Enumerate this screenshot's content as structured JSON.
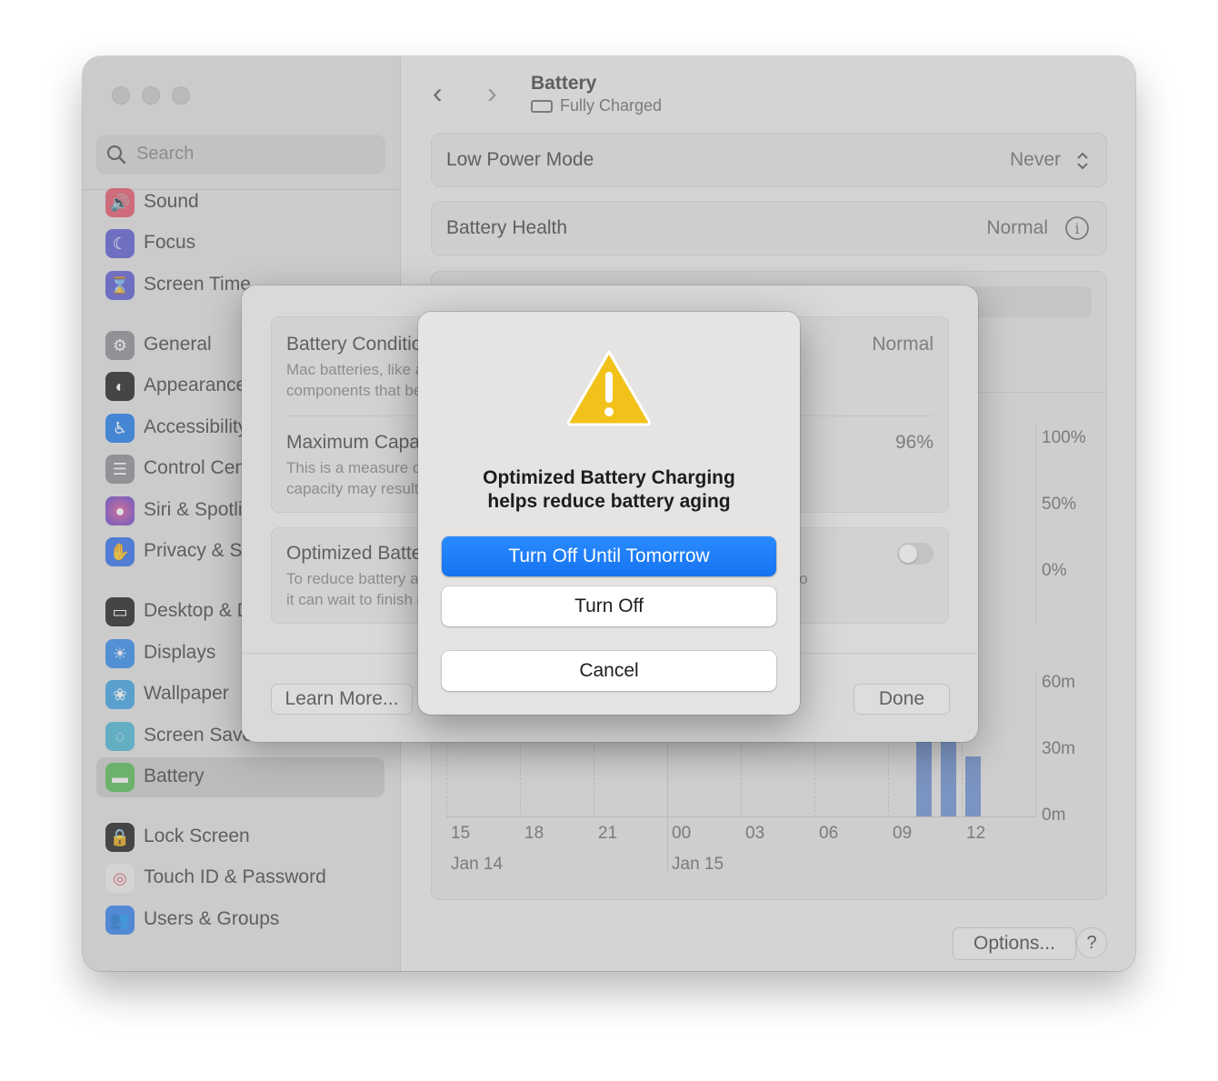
{
  "window": {
    "title": "Battery",
    "subtitle": "Fully Charged"
  },
  "sidebar": {
    "search_placeholder": "Search",
    "items": [
      {
        "label": "Sound",
        "icon": "speaker-icon",
        "color": "#e8566b"
      },
      {
        "label": "Focus",
        "icon": "moon-icon",
        "color": "#5a5ad6"
      },
      {
        "label": "Screen Time",
        "icon": "hourglass-icon",
        "color": "#5a5ad6"
      },
      {
        "label": "General",
        "icon": "gear-icon",
        "color": "#8e8e93"
      },
      {
        "label": "Appearance",
        "icon": "appearance-icon",
        "color": "#1c1c1e"
      },
      {
        "label": "Accessibility",
        "icon": "accessibility-icon",
        "color": "#1a7cf0"
      },
      {
        "label": "Control Centre",
        "icon": "control-centre-icon",
        "color": "#8e8e93"
      },
      {
        "label": "Siri & Spotlight",
        "icon": "siri-icon",
        "color": "#8a3fd6"
      },
      {
        "label": "Privacy & Security",
        "icon": "hand-icon",
        "color": "#2f6ff0"
      },
      {
        "label": "Desktop & Dock",
        "icon": "desktop-icon",
        "color": "#1c1c1e"
      },
      {
        "label": "Displays",
        "icon": "sun-icon",
        "color": "#2f8cf0"
      },
      {
        "label": "Wallpaper",
        "icon": "flower-icon",
        "color": "#3aa3e8"
      },
      {
        "label": "Screen Saver",
        "icon": "screensaver-icon",
        "color": "#48b8d8"
      },
      {
        "label": "Battery",
        "icon": "battery-icon",
        "color": "#5cc45c"
      },
      {
        "label": "Lock Screen",
        "icon": "lock-icon",
        "color": "#1c1c1e"
      },
      {
        "label": "Touch ID & Password",
        "icon": "fingerprint-icon",
        "color": "#f0f0f0"
      },
      {
        "label": "Users & Groups",
        "icon": "users-icon",
        "color": "#2f7ff0"
      }
    ]
  },
  "content": {
    "low_power_mode": {
      "label": "Low Power Mode",
      "value": "Never"
    },
    "battery_health": {
      "label": "Battery Health",
      "value": "Normal"
    },
    "chart": {
      "level_ticks": [
        "100%",
        "50%",
        "0%"
      ],
      "usage_ticks": [
        "60m",
        "30m",
        "0m"
      ],
      "hour_labels": [
        "15",
        "18",
        "21",
        "00",
        "03",
        "06",
        "09",
        "12"
      ],
      "date_labels": [
        "Jan 14",
        "Jan 15"
      ],
      "usage_bars_minutes": [
        58,
        58,
        27
      ]
    },
    "options_label": "Options...",
    "help_label": "?"
  },
  "sheet": {
    "condition": {
      "title": "Battery Condition",
      "desc1": "Mac batteries, like all rechargeable batteries, are consumable",
      "desc2": "components that become less effective as they age.",
      "value": "Normal"
    },
    "capacity": {
      "title": "Maximum Capacity",
      "desc1": "This is a measure of battery capacity relative to when it was new. Lower",
      "desc2": "capacity may result in fewer hours of use between charges.",
      "value": "96%"
    },
    "optimized": {
      "title": "Optimized Battery Charging",
      "desc1": "To reduce battery aging, your Mac learns from your daily charging routine so",
      "desc2": "it can wait to finish charging past 80% until you need to use it on battery."
    },
    "learn_more": "Learn More...",
    "done": "Done"
  },
  "alert": {
    "message_line1": "Optimized Battery Charging",
    "message_line2": "helps reduce battery aging",
    "primary": "Turn Off Until Tomorrow",
    "secondary": "Turn Off",
    "cancel": "Cancel"
  },
  "colors": {
    "accent": "#1a7cf7",
    "warning": "#f2c21b"
  }
}
